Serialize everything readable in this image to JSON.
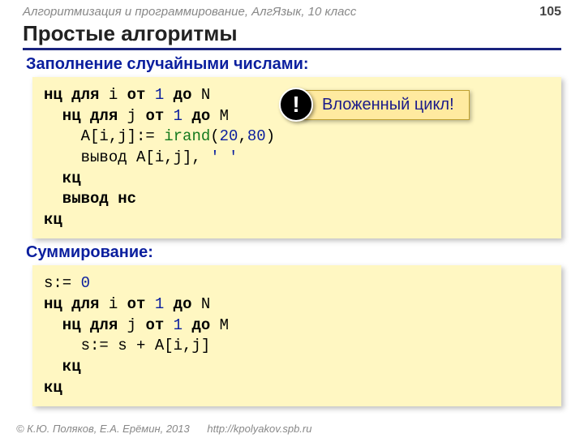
{
  "header": {
    "course": "Алгоритмизация и программирование, АлгЯзык, 10 класс",
    "page": "105"
  },
  "title": "Простые алгоритмы",
  "section1": "Заполнение случайными числами:",
  "code1": {
    "l1a": "нц для",
    "l1b": " i ",
    "l1c": "от",
    "l1d": " 1 ",
    "l1e": "до",
    "l1f": " N",
    "l2a": "  нц для",
    "l2b": " j ",
    "l2c": "от",
    "l2d": " 1 ",
    "l2e": "до",
    "l2f": " M",
    "l3a": "    A[i,j]:= ",
    "l3b": "irand",
    "l3c": "(",
    "l3d": "20",
    "l3e": ",",
    "l3f": "80",
    "l3g": ")",
    "l4a": "    вывод A[i,j], ",
    "l4b": "' '",
    "l5": "  кц",
    "l6": "  вывод нс",
    "l7": "кц"
  },
  "callout": {
    "mark": "!",
    "text": "Вложенный цикл!"
  },
  "section2": "Суммирование:",
  "code2": {
    "l1a": "s:= ",
    "l1b": "0",
    "l2a": "нц для",
    "l2b": " i ",
    "l2c": "от",
    "l2d": " 1 ",
    "l2e": "до",
    "l2f": " N",
    "l3a": "  нц для",
    "l3b": " j ",
    "l3c": "от",
    "l3d": " 1 ",
    "l3e": "до",
    "l3f": " M",
    "l4": "    s:= s + A[i,j]",
    "l5": "  кц",
    "l6": "кц"
  },
  "footer": {
    "copyright": "© К.Ю. Поляков, Е.А. Ерёмин, 2013",
    "url": "http://kpolyakov.spb.ru"
  }
}
